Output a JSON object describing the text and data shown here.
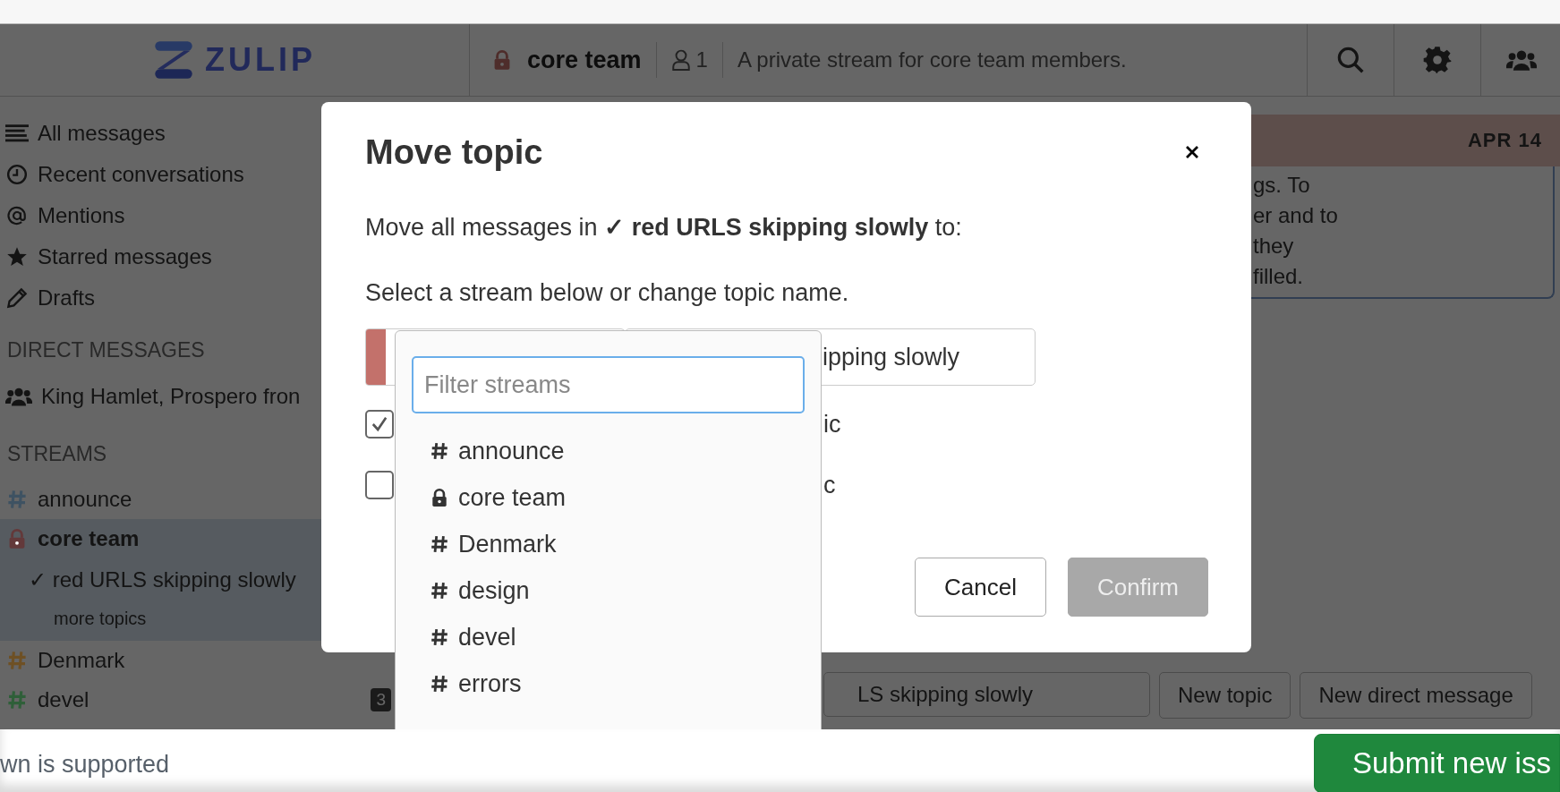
{
  "navbar": {
    "logo": "ZULIP",
    "stream": {
      "name": "core team",
      "private": true
    },
    "subscriber_count": "1",
    "description": "A private stream for core team members."
  },
  "sidebar": {
    "views": [
      {
        "kind": "all",
        "label": "All messages"
      },
      {
        "kind": "recent",
        "label": "Recent conversations"
      },
      {
        "kind": "mentions",
        "label": "Mentions"
      },
      {
        "kind": "starred",
        "label": "Starred messages"
      },
      {
        "kind": "drafts",
        "label": "Drafts"
      }
    ],
    "direct_messages": {
      "heading": "DIRECT MESSAGES",
      "items": [
        {
          "label": "King Hamlet, Prospero fron"
        }
      ]
    },
    "streams": {
      "heading": "STREAMS",
      "items": [
        {
          "name": "announce",
          "color": "#3e5262",
          "private": false,
          "selected": false
        },
        {
          "name": "core team",
          "color": "#63393a",
          "private": true,
          "selected": true,
          "topics": [
            {
              "name": "✓ red URLS skipping slowly"
            }
          ],
          "more_topics": "more topics"
        },
        {
          "name": "Denmark",
          "color": "#6e5024",
          "private": false,
          "selected": false
        },
        {
          "name": "devel",
          "color": "#2f5f39",
          "private": false,
          "selected": false,
          "unread": "3"
        }
      ]
    }
  },
  "message_area": {
    "date": "APR 14",
    "text_lines": [
      "gs. To",
      "er and to",
      "they",
      "filled."
    ]
  },
  "compose": {
    "topic": "LS skipping slowly",
    "buttons": [
      "New topic",
      "New direct message"
    ]
  },
  "modal": {
    "title": "Move topic",
    "intro": "Move all messages in **✓ red URLS skipping slowly** to:",
    "hint": "Select a stream below or change topic name.",
    "topic_value": "ipping slowly",
    "checkboxes": [
      {
        "label": "ic",
        "checked": true
      },
      {
        "label": "c",
        "checked": false
      }
    ],
    "buttons": [
      {
        "label": "Cancel",
        "disabled": false
      },
      {
        "label": "Confirm",
        "disabled": true
      }
    ]
  },
  "stream_dropdown": {
    "placeholder": "Filter streams",
    "items": [
      {
        "name": "announce",
        "private": false
      },
      {
        "name": "core team",
        "private": true
      },
      {
        "name": "Denmark",
        "private": false
      },
      {
        "name": "design",
        "private": false
      },
      {
        "name": "devel",
        "private": false
      },
      {
        "name": "errors",
        "private": false
      }
    ]
  },
  "page_footer": {
    "hint": "wn is supported",
    "submit_button": "Submit new iss"
  }
}
